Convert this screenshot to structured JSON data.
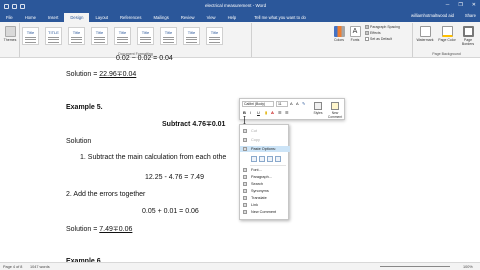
{
  "titlebar": {
    "title": "electrical measurement - Word",
    "controls": [
      "─",
      "❐",
      "✕"
    ]
  },
  "tabs": [
    {
      "label": "File"
    },
    {
      "label": "Home"
    },
    {
      "label": "Insert"
    },
    {
      "label": "Design",
      "active": true
    },
    {
      "label": "Layout"
    },
    {
      "label": "References"
    },
    {
      "label": "Mailings"
    },
    {
      "label": "Review"
    },
    {
      "label": "View"
    },
    {
      "label": "Help"
    }
  ],
  "tell_me": "Tell me what you want to do",
  "user": "williamhotmaltwood aid",
  "share": "Share",
  "ribbon": {
    "themes_label": "Themes",
    "styles": [
      "Title",
      "TITLE",
      "Title",
      "Title",
      "Title",
      "Title",
      "Title",
      "Title",
      "Title"
    ],
    "group_document_formatting": "Document Formatting",
    "colors_label": "Colors",
    "fonts_label": "Fonts",
    "paragraph_spacing": "Paragraph Spacing",
    "effects": "Effects",
    "set_default": "Set as Default",
    "watermark": "Watermark",
    "page_color": "Page Color",
    "page_borders": "Page Borders",
    "group_page_background": "Page Background"
  },
  "document": {
    "line1": "0.02 − 0.02 = 0.04",
    "sol1_prefix": "Solution = ",
    "sol1_value": "22.96∓0.04",
    "example5": "Example 5.",
    "subtract": "Subtract  4.76∓0.01",
    "solution": "Solution",
    "step1": "1.    Subtract the main calculation from each othe",
    "calc1": "12.25 - 4.76 = 7.49",
    "step2": "2.  Add the errors together",
    "calc2": "0.05 + 0.01 = 0.06",
    "sol2_prefix": "Solution = ",
    "sol2_value": "7.49∓0.06",
    "example6": "Example 6"
  },
  "mini_toolbar": {
    "font": "Calibri (Body)",
    "size": "11",
    "bold": "B",
    "italic": "I",
    "underline": "U",
    "styles": "Styles",
    "new_comment": "New Comment"
  },
  "context_menu": {
    "cut": "Cut",
    "copy": "Copy",
    "paste_options": "Paste Options:",
    "font": "Font...",
    "paragraph": "Paragraph...",
    "search": "Search",
    "synonyms": "Synonyms",
    "translate": "Translate",
    "link": "Link",
    "new_comment": "New Comment"
  },
  "statusbar": {
    "page": "Page 4 of 8",
    "words": "1047 words",
    "zoom": "100%"
  }
}
